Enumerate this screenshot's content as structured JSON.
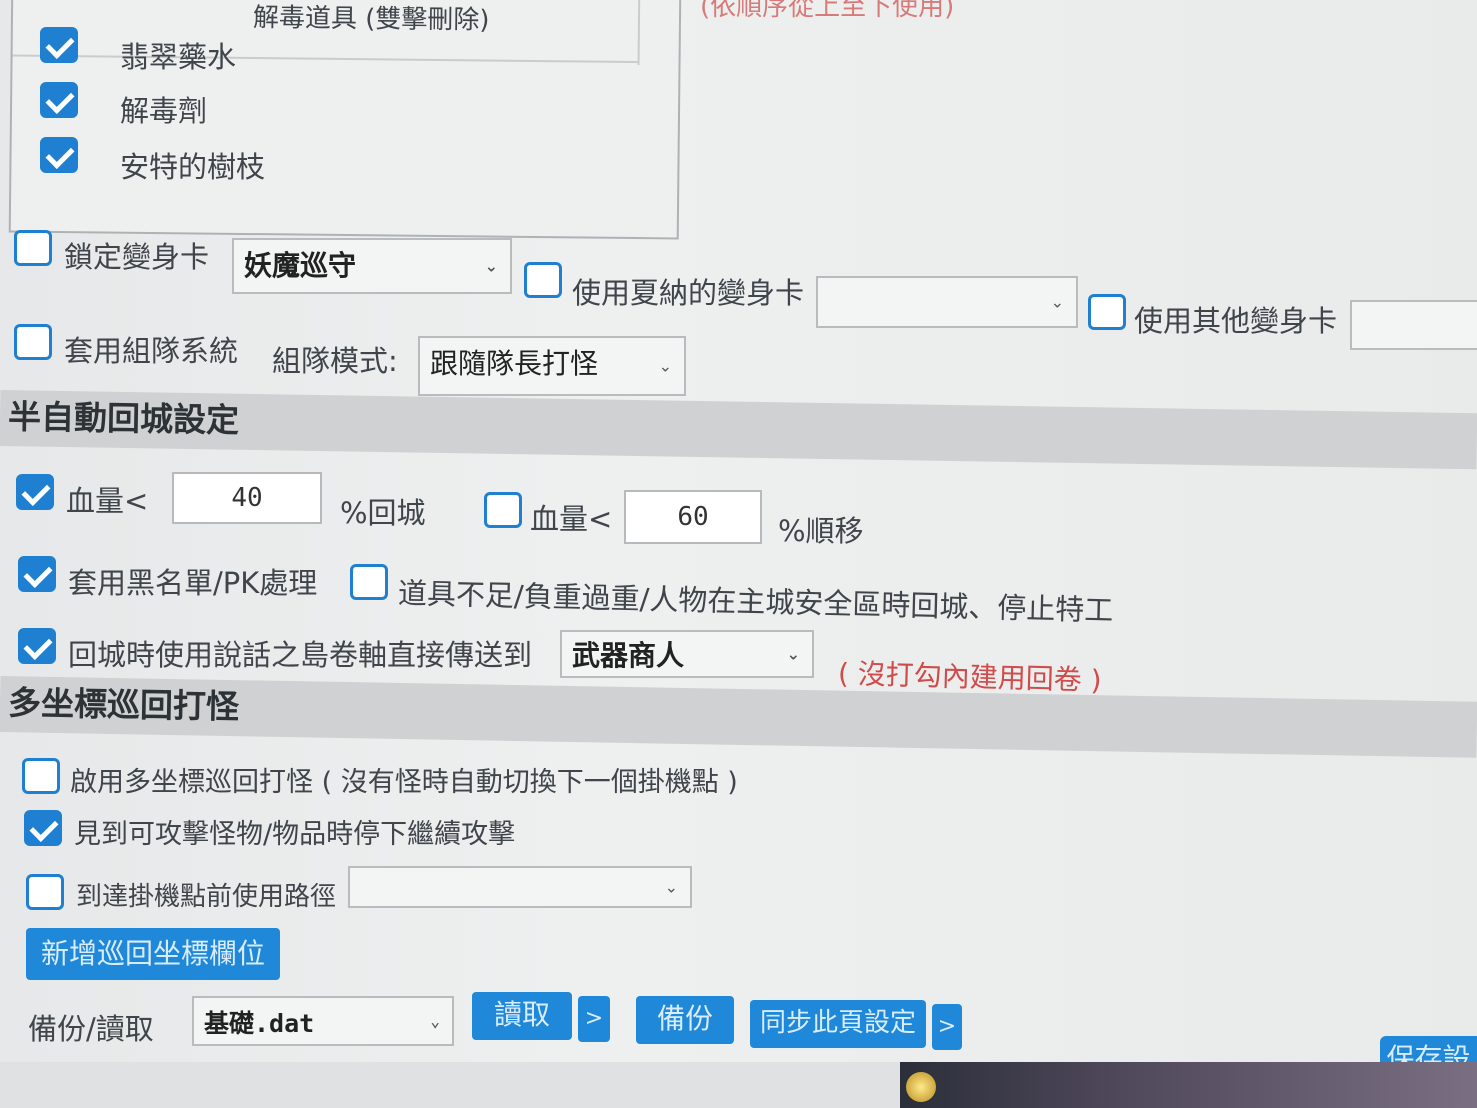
{
  "top_partial": "(依順序從上至下使用)",
  "antidote_box": {
    "title": "解毒道具 (雙擊刪除)",
    "items": [
      {
        "label": "翡翠藥水",
        "checked": true
      },
      {
        "label": "解毒劑",
        "checked": true
      },
      {
        "label": "安特的樹枝",
        "checked": true
      }
    ]
  },
  "transform": {
    "lock_label": "鎖定變身卡",
    "lock_checked": false,
    "lock_value": "妖魔巡守",
    "shana_label": "使用夏納的變身卡",
    "shana_checked": false,
    "shana_value": "",
    "other_label": "使用其他變身卡",
    "other_checked": false
  },
  "party": {
    "label": "套用組隊系統",
    "checked": false,
    "mode_label": "組隊模式:",
    "mode_value": "跟隨隊長打怪"
  },
  "semi_auto": {
    "title": "半自動回城設定",
    "hp1_label": "血量<",
    "hp1_checked": true,
    "hp1_value": "40",
    "hp1_suffix": "%回城",
    "hp2_label": "血量<",
    "hp2_checked": false,
    "hp2_value": "60",
    "hp2_suffix": "%順移",
    "blacklist_label": "套用黑名單/PK處理",
    "blacklist_checked": true,
    "shortage_label": "道具不足/負重過重/人物在主城安全區時回城、停止特工",
    "shortage_checked": false,
    "scroll_label": "回城時使用說話之島卷軸直接傳送到",
    "scroll_checked": true,
    "scroll_value": "武器商人",
    "scroll_note": "( 沒打勾內建用回卷 )"
  },
  "patrol": {
    "title": "多坐標巡回打怪",
    "enable_label": "啟用多坐標巡回打怪 ( 沒有怪時自動切換下一個掛機點 )",
    "enable_checked": false,
    "stop_label": "見到可攻擊怪物/物品時停下繼續攻擊",
    "stop_checked": true,
    "path_label": "到達掛機點前使用路徑",
    "path_checked": false,
    "path_value": "",
    "add_button": "新增巡回坐標欄位"
  },
  "backup": {
    "label": "備份/讀取",
    "file_value": "基礎.dat",
    "read_button": "讀取",
    "read_more": ">",
    "backup_button": "備份",
    "sync_button": "同步此頁設定",
    "sync_more": ">",
    "save_button": "保存設"
  },
  "colors": {
    "accent": "#1f7fd1",
    "section_bg": "#cfd1d2",
    "note_red": "#d04b4b"
  }
}
